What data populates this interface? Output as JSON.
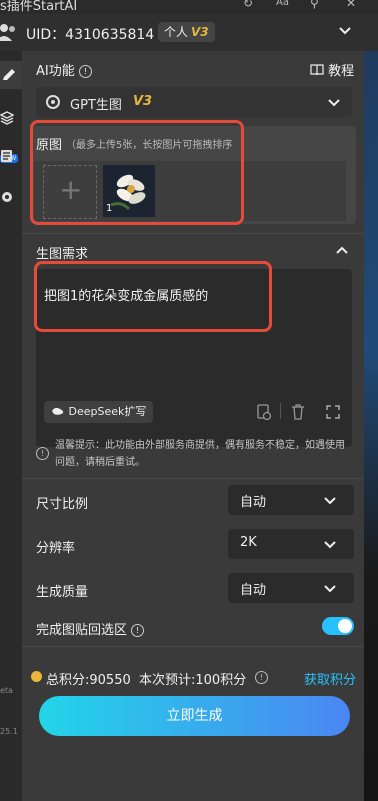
{
  "window": {
    "title": "s插件StartAI"
  },
  "user": {
    "uid_text": "UID：4310635814",
    "plan": "个人",
    "plan_tier": "V3"
  },
  "sidebar": {
    "new_badge": "NEW",
    "version_1": "eta",
    "version_2": "25.1"
  },
  "ai_function": {
    "label": "AI功能",
    "tutorial_label": "教程",
    "selected_model": "GPT生图",
    "model_tier": "V3"
  },
  "source_images": {
    "title": "原图",
    "hint": "（最多上传5张，长按图片可拖拽排序",
    "thumb_index": "1"
  },
  "prompt_section": {
    "title": "生图需求",
    "prompt_text": "把图1的花朵变成金属质感的",
    "deepseek_label": "DeepSeek扩写"
  },
  "notice": {
    "text": "温馨提示：此功能由外部服务商提供，偶有服务不稳定，如遇使用问题，请稍后重试。"
  },
  "settings": {
    "aspect_label": "尺寸比例",
    "aspect_value": "自动",
    "resolution_label": "分辨率",
    "resolution_value": "2K",
    "quality_label": "生成质量",
    "quality_value": "自动",
    "paste_back_label": "完成图贴回选区",
    "paste_back_enabled": true
  },
  "points": {
    "summary": "总积分:90550  本次预计:100积分",
    "get_points_label": "获取积分"
  },
  "generate_label": "立即生成",
  "colors": {
    "accent": "#28c1ff",
    "highlight_box": "#e84a3a",
    "tier_gold": "#e4b640"
  }
}
